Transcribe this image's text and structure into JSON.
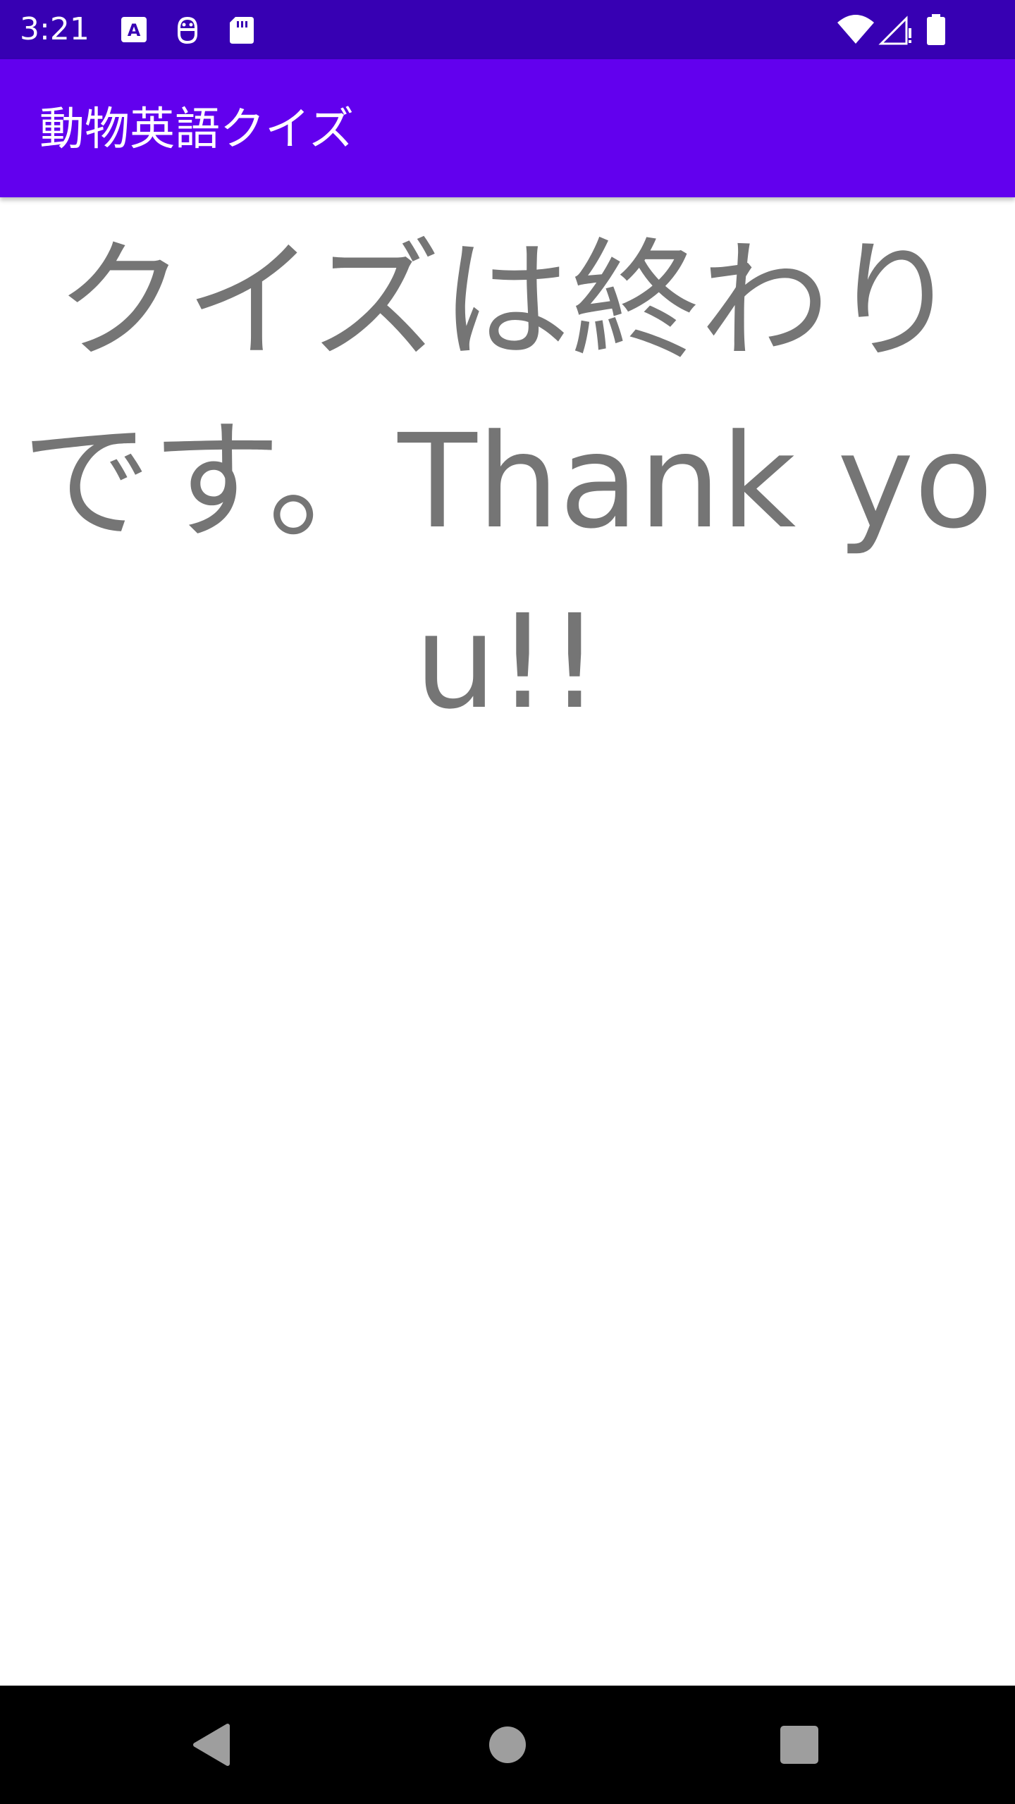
{
  "status_bar": {
    "time": "3:21",
    "icons_left": [
      "font-a-icon",
      "android-debug-icon",
      "sd-card-icon"
    ],
    "icons_right": [
      "wifi-icon",
      "cell-signal-icon",
      "battery-icon"
    ]
  },
  "app_bar": {
    "title": "動物英語クイズ"
  },
  "main": {
    "message": "クイズは終わりです。Thank you!!"
  },
  "nav_bar": {
    "buttons": [
      "back-icon",
      "home-icon",
      "recents-icon"
    ]
  },
  "colors": {
    "status_bar": "#3700b3",
    "app_bar": "#6200ee",
    "message_text": "#757575",
    "nav_bar": "#000000"
  }
}
